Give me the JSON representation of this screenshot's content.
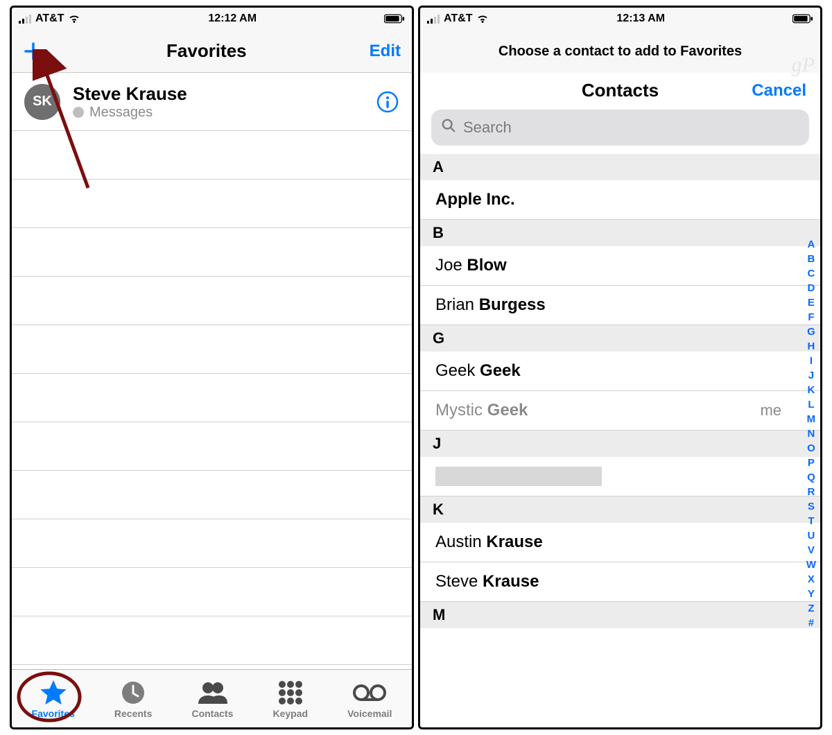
{
  "left": {
    "status": {
      "carrier": "AT&T",
      "time": "12:12 AM"
    },
    "nav": {
      "title": "Favorites",
      "edit": "Edit"
    },
    "favorite": {
      "initials": "SK",
      "name": "Steve Krause",
      "sub": "Messages"
    },
    "tabs": {
      "favorites": "Favorites",
      "recents": "Recents",
      "contacts": "Contacts",
      "keypad": "Keypad",
      "voicemail": "Voicemail"
    }
  },
  "right": {
    "status": {
      "carrier": "AT&T",
      "time": "12:13 AM"
    },
    "instruction": "Choose a contact to add to Favorites",
    "header": {
      "title": "Contacts",
      "cancel": "Cancel"
    },
    "search": {
      "placeholder": "Search"
    },
    "sections": {
      "A": {
        "label": "A",
        "entry1_first": "",
        "entry1_last": "Apple Inc."
      },
      "B": {
        "label": "B",
        "entry1_first": "Joe ",
        "entry1_last": "Blow",
        "entry2_first": "Brian ",
        "entry2_last": "Burgess"
      },
      "G": {
        "label": "G",
        "entry1_first": "Geek ",
        "entry1_last": "Geek",
        "entry2_first": "Mystic ",
        "entry2_last": "Geek",
        "entry2_me": "me"
      },
      "J": {
        "label": "J"
      },
      "K": {
        "label": "K",
        "entry1_first": "Austin ",
        "entry1_last": "Krause",
        "entry2_first": "Steve ",
        "entry2_last": "Krause"
      },
      "M": {
        "label": "M"
      }
    },
    "index": [
      "A",
      "B",
      "C",
      "D",
      "E",
      "F",
      "G",
      "H",
      "I",
      "J",
      "K",
      "L",
      "M",
      "N",
      "O",
      "P",
      "Q",
      "R",
      "S",
      "T",
      "U",
      "V",
      "W",
      "X",
      "Y",
      "Z",
      "#"
    ],
    "watermark": "gP"
  }
}
